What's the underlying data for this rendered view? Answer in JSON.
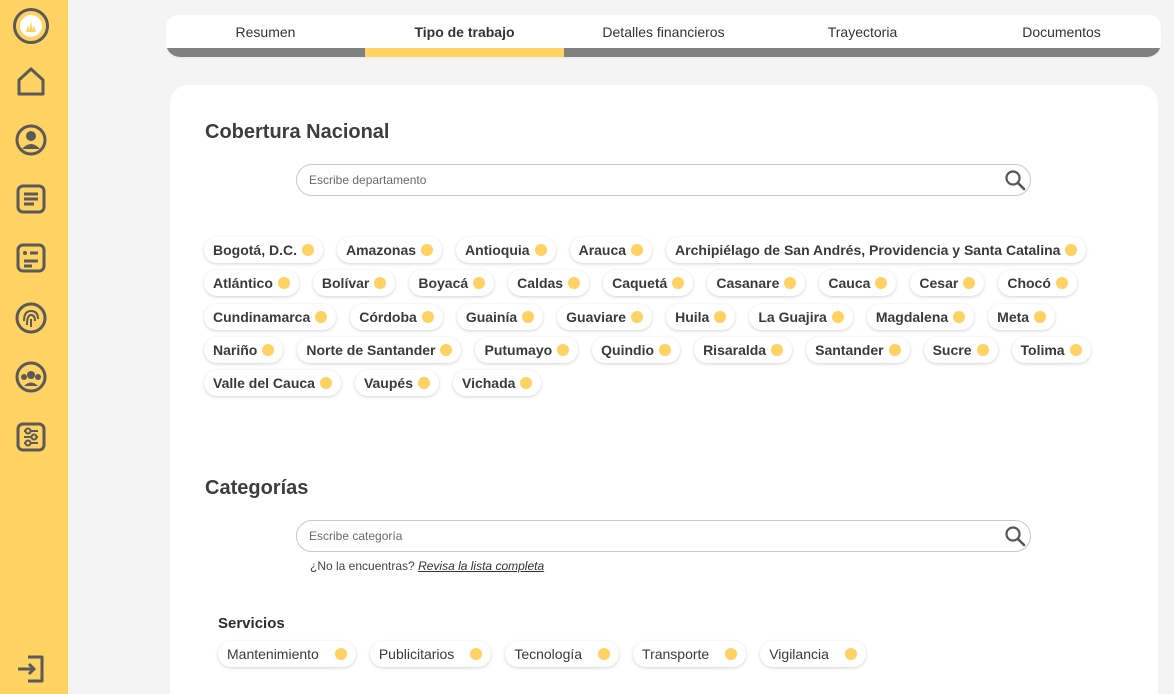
{
  "theme": {
    "accent": "#ffd262",
    "icon_color": "#5a5a5a",
    "tab_bar_inactive": "#808080"
  },
  "sidebar": {
    "icons": [
      "logo-icon",
      "home-icon",
      "profile-icon",
      "list-icon",
      "document-icon",
      "fingerprint-icon",
      "team-icon",
      "settings-icon",
      "logout-icon"
    ]
  },
  "tabs": [
    {
      "label": "Resumen",
      "active": false
    },
    {
      "label": "Tipo de trabajo",
      "active": true
    },
    {
      "label": "Detalles financieros",
      "active": false
    },
    {
      "label": "Trayectoria",
      "active": false
    },
    {
      "label": "Documentos",
      "active": false
    }
  ],
  "coverage": {
    "title": "Cobertura Nacional",
    "search_placeholder": "Escribe departamento",
    "rows": [
      [
        "Bogotá, D.C.",
        "Amazonas",
        "Antioquia",
        "Arauca",
        "Archipiélago de San Andrés, Providencia y Santa Catalina"
      ],
      [
        "Atlántico",
        "Bolívar",
        "Boyacá",
        "Caldas",
        "Caquetá",
        "Casanare",
        "Cauca",
        "Cesar",
        "Chocó"
      ],
      [
        "Cundinamarca",
        "Córdoba",
        "Guainía",
        "Guaviare",
        "Huila",
        "La Guajira",
        "Magdalena",
        "Meta"
      ],
      [
        "Nariño",
        "Norte de Santander",
        "Putumayo",
        "Quindio",
        "Risaralda",
        "Santander",
        "Sucre",
        "Tolima"
      ],
      [
        "Valle del Cauca",
        "Vaupés",
        "Vichada"
      ]
    ]
  },
  "categories": {
    "title": "Categorías",
    "search_placeholder": "Escribe categoría",
    "hint_text": "¿No la encuentras?",
    "hint_link": "Revisa la lista completa",
    "group_title": "Servicios",
    "items": [
      "Mantenimiento",
      "Publicitarios",
      "Tecnología",
      "Transporte",
      "Vigilancia"
    ]
  }
}
